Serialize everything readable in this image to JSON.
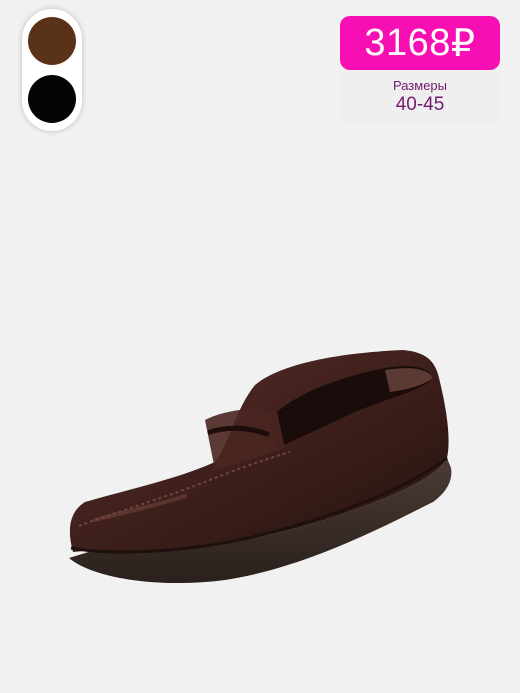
{
  "colors": {
    "page_background": "#f1f1f1",
    "price_badge": "#f70fb3",
    "sizes_text": "#731b6f",
    "swatch_brown": "#5a3218",
    "swatch_black": "#050505",
    "leather": "#3b1e1a",
    "sole": "#3a2d28"
  },
  "color_swatches": [
    {
      "name": "brown"
    },
    {
      "name": "black"
    }
  ],
  "price": {
    "value": "3168",
    "currency": "₽"
  },
  "sizes": {
    "label": "Размеры",
    "value": "40-45"
  },
  "product_image": {
    "subject": "dark brown leather penny loafer"
  }
}
